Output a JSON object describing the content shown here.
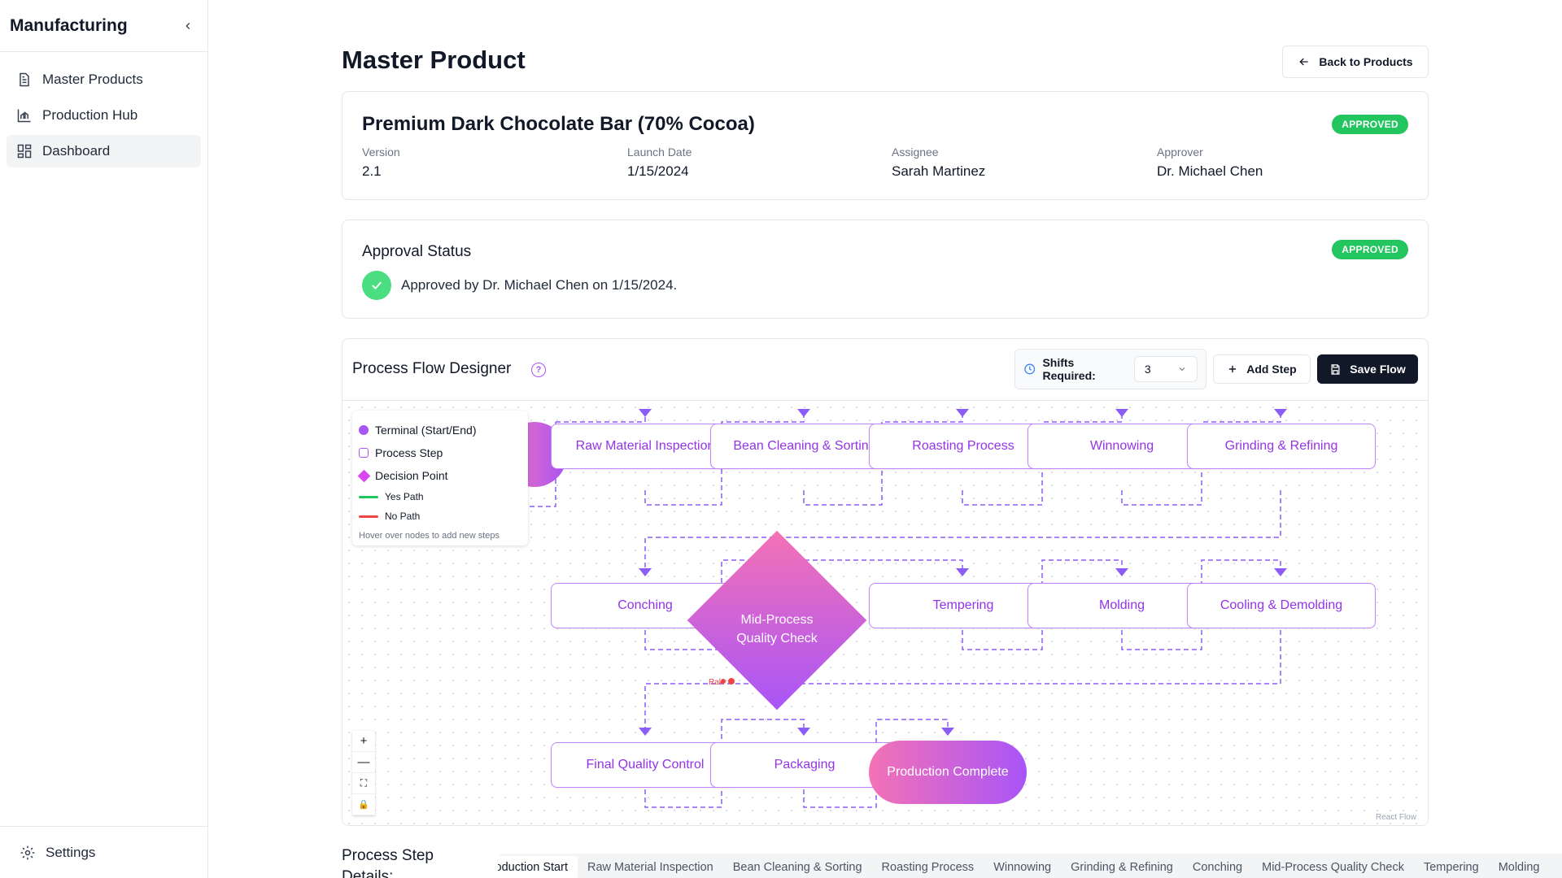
{
  "sidebar": {
    "title": "Manufacturing",
    "items": [
      {
        "label": "Master Products",
        "icon": "document-icon"
      },
      {
        "label": "Production Hub",
        "icon": "chart-icon"
      },
      {
        "label": "Dashboard",
        "icon": "grid-icon"
      }
    ],
    "settings_label": "Settings"
  },
  "page": {
    "title": "Master Product",
    "back_label": "Back to Products"
  },
  "product": {
    "name": "Premium Dark Chocolate Bar (70% Cocoa)",
    "status": "APPROVED",
    "version_label": "Version",
    "version": "2.1",
    "launch_label": "Launch Date",
    "launch_date": "1/15/2024",
    "assignee_label": "Assignee",
    "assignee": "Sarah Martinez",
    "approver_label": "Approver",
    "approver": "Dr. Michael Chen"
  },
  "approval": {
    "title": "Approval Status",
    "status": "APPROVED",
    "text": "Approved by Dr. Michael Chen on 1/15/2024."
  },
  "flow": {
    "title": "Process Flow Designer",
    "help": "?",
    "shifts_label": "Shifts Required:",
    "shifts_value": "3",
    "add_step": "Add Step",
    "save_flow": "Save Flow",
    "legend": {
      "terminal": "Terminal (Start/End)",
      "process": "Process Step",
      "decision": "Decision Point",
      "yes": "Yes Path",
      "no": "No Path",
      "hint": "Hover over nodes to add new steps"
    },
    "nodes": {
      "n1": "Raw Material Inspection",
      "n2": "Bean Cleaning & Sorting",
      "n3": "Roasting Process",
      "n4": "Winnowing",
      "n5": "Grinding & Refining",
      "n6": "Conching",
      "n7": "Mid-Process Quality Check",
      "n8": "Tempering",
      "n9": "Molding",
      "n10": "Cooling & Demolding",
      "n11": "Final Quality Control",
      "n12": "Packaging",
      "n13": "Production Complete"
    },
    "edge_label": "Rak",
    "zoom": {
      "in": "+",
      "out": "—",
      "fit": "⛶",
      "lock": "🔒"
    },
    "attribution": "React Flow"
  },
  "details": {
    "title": "Process Step Details:",
    "tabs": [
      "Production Start",
      "Raw Material Inspection",
      "Bean Cleaning & Sorting",
      "Roasting Process",
      "Winnowing",
      "Grinding & Refining",
      "Conching",
      "Mid-Process Quality Check",
      "Tempering",
      "Molding"
    ]
  },
  "colors": {
    "accent": "#a855f7",
    "approved": "#22c55e",
    "edge": "#8b5cf6",
    "no_path": "#ef4444",
    "yes_path": "#22c55e"
  }
}
